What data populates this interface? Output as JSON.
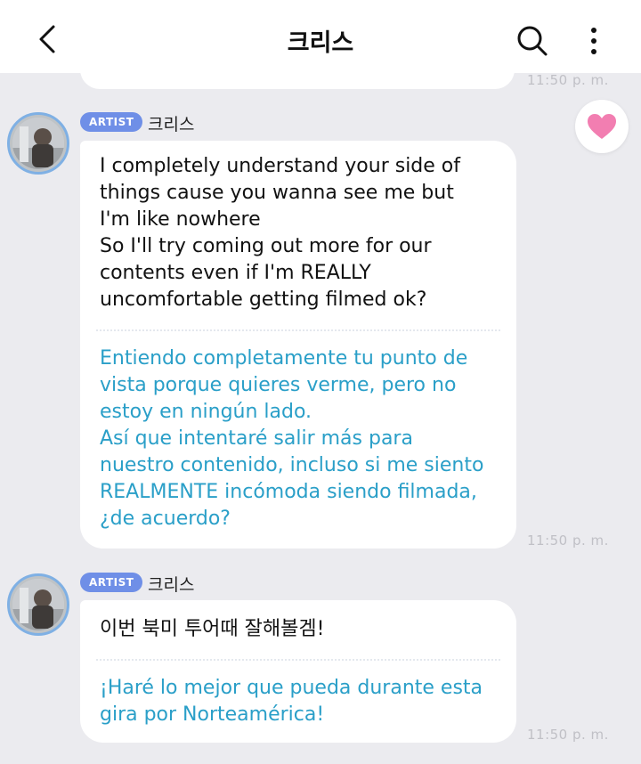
{
  "header": {
    "title": "크리스",
    "back_icon": "chevron-left-icon",
    "search_icon": "search-icon",
    "more_icon": "more-vertical-icon"
  },
  "colors": {
    "background": "#ebebef",
    "badge": "#6f8fe7",
    "translation_text": "#2a9fc8",
    "heart": "#f27eb1"
  },
  "previous_message": {
    "time": "11:50 p. m."
  },
  "messages": [
    {
      "badge": "ARTIST",
      "sender": "크리스",
      "original": "I completely understand your side of\nthings cause you wanna see me but\nI'm like nowhere\nSo I'll try coming out more for our\ncontents even if I'm REALLY\nuncomfortable getting filmed ok?",
      "translation": "Entiendo completamente tu punto de\nvista porque quieres verme, pero no\nestoy en ningún lado.\nAsí que intentaré salir más para\nnuestro contenido, incluso si me siento\nREALMENTE incómoda siendo filmada,\n¿de acuerdo?",
      "time": "11:50 p. m.",
      "liked": true
    },
    {
      "badge": "ARTIST",
      "sender": "크리스",
      "original": "이번 북미 투어때 잘해볼겜!",
      "translation": "¡Haré lo mejor que pueda durante esta\ngira por Norteamérica!",
      "time": "11:50 p. m."
    }
  ]
}
